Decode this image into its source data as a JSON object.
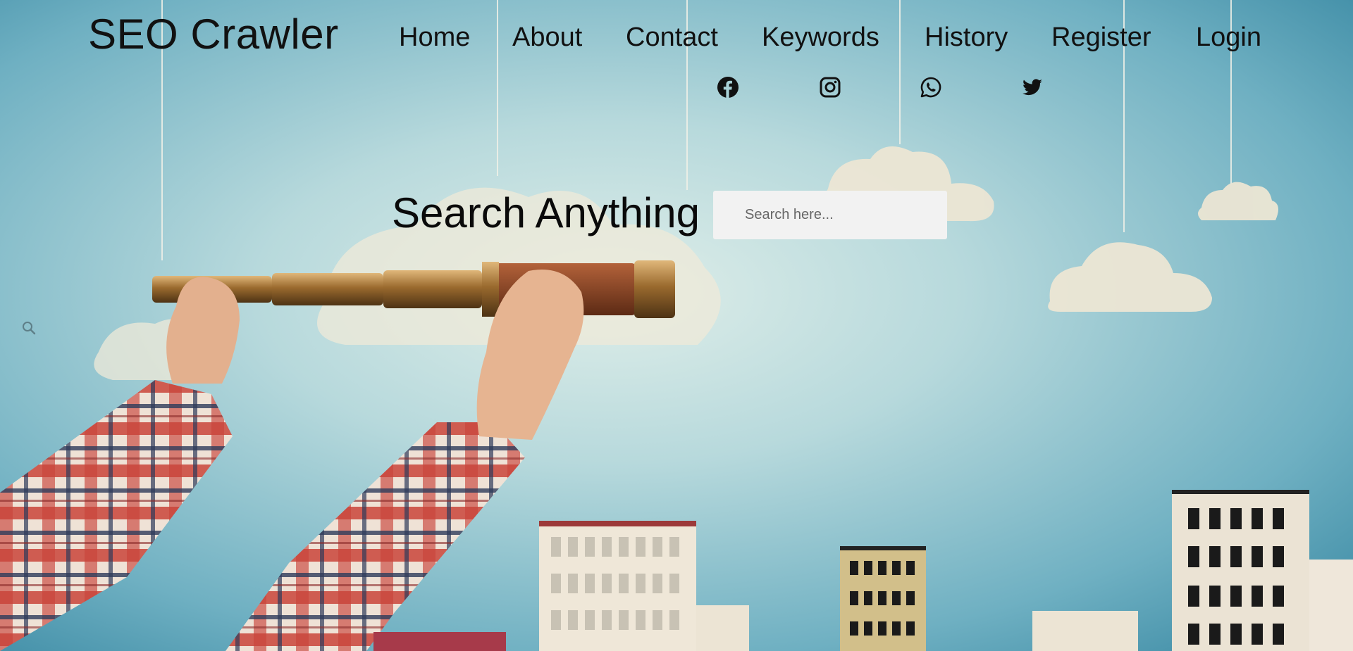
{
  "brand": {
    "title": "SEO Crawler"
  },
  "nav": {
    "home": "Home",
    "about": "About",
    "contact": "Contact",
    "keywords": "Keywords",
    "history": "History",
    "register": "Register",
    "login": "Login"
  },
  "social": {
    "icons": [
      "facebook-icon",
      "instagram-icon",
      "whatsapp-icon",
      "twitter-icon"
    ]
  },
  "hero": {
    "title": "Search Anything",
    "search_placeholder": "Search here..."
  },
  "colors": {
    "sky": "#8cc3cf",
    "text": "#111111",
    "search_bg": "#f2f2f2"
  }
}
